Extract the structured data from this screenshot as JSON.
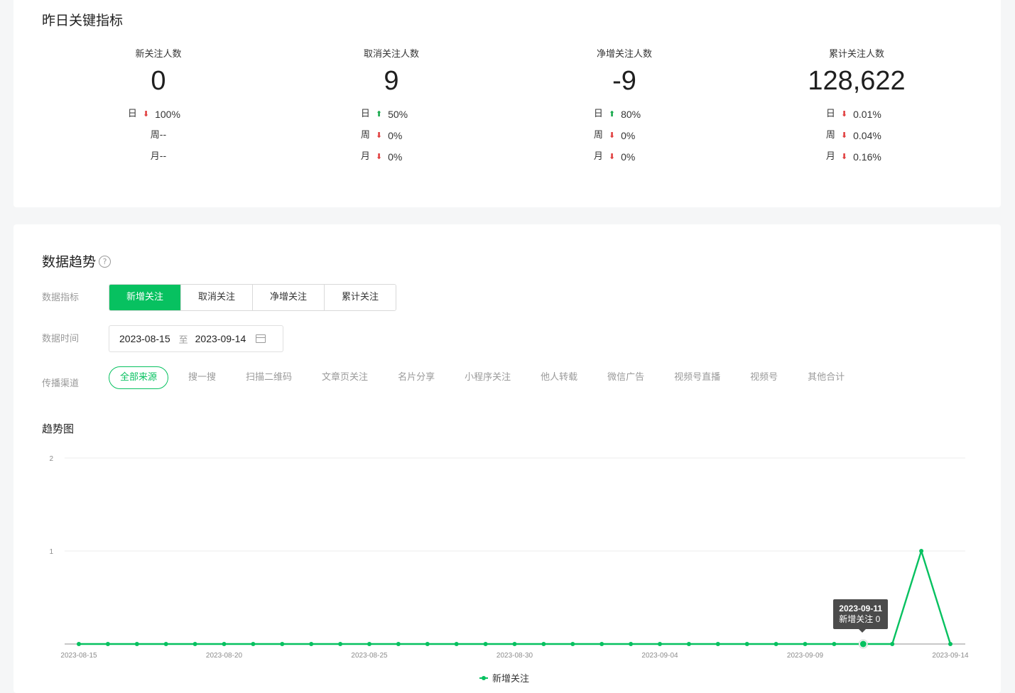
{
  "metrics_section": {
    "title": "昨日关键指标",
    "metrics": [
      {
        "label": "新关注人数",
        "value": "0",
        "rows": [
          {
            "period": "日",
            "direction": "down",
            "pct": "100%"
          },
          {
            "period": "周--",
            "direction": "none",
            "pct": ""
          },
          {
            "period": "月--",
            "direction": "none",
            "pct": ""
          }
        ]
      },
      {
        "label": "取消关注人数",
        "value": "9",
        "rows": [
          {
            "period": "日",
            "direction": "up",
            "pct": "50%"
          },
          {
            "period": "周",
            "direction": "down",
            "pct": "0%"
          },
          {
            "period": "月",
            "direction": "down",
            "pct": "0%"
          }
        ]
      },
      {
        "label": "净增关注人数",
        "value": "-9",
        "rows": [
          {
            "period": "日",
            "direction": "up",
            "pct": "80%"
          },
          {
            "period": "周",
            "direction": "down",
            "pct": "0%"
          },
          {
            "period": "月",
            "direction": "down",
            "pct": "0%"
          }
        ]
      },
      {
        "label": "累计关注人数",
        "value": "128,622",
        "rows": [
          {
            "period": "日",
            "direction": "down",
            "pct": "0.01%"
          },
          {
            "period": "周",
            "direction": "down",
            "pct": "0.04%"
          },
          {
            "period": "月",
            "direction": "down",
            "pct": "0.16%"
          }
        ]
      }
    ]
  },
  "trend_section": {
    "title": "数据趋势",
    "help_icon": "?",
    "metric_label": "数据指标",
    "metric_tabs": [
      "新增关注",
      "取消关注",
      "净增关注",
      "累计关注"
    ],
    "active_metric": 0,
    "time_label": "数据时间",
    "date_from": "2023-08-15",
    "date_sep": "至",
    "date_to": "2023-09-14",
    "channel_label": "传播渠道",
    "channels": [
      "全部来源",
      "搜一搜",
      "扫描二维码",
      "文章页关注",
      "名片分享",
      "小程序关注",
      "他人转载",
      "微信广告",
      "视频号直播",
      "视频号",
      "其他合计"
    ],
    "active_channel": 0,
    "chart_title": "趋势图",
    "tooltip": {
      "date": "2023-09-11",
      "text": "新增关注 0"
    }
  },
  "colors": {
    "accent": "#07c160",
    "down": "#e03e3e",
    "up": "#14a84a"
  },
  "chart_data": {
    "type": "line",
    "title": "",
    "xlabel": "",
    "ylabel": "",
    "ylim": [
      0,
      2
    ],
    "yticks": [
      1,
      2
    ],
    "x_tick_labels": [
      "2023-08-15",
      "2023-08-20",
      "2023-08-25",
      "2023-08-30",
      "2023-09-04",
      "2023-09-09",
      "2023-09-14"
    ],
    "x": [
      "2023-08-15",
      "2023-08-16",
      "2023-08-17",
      "2023-08-18",
      "2023-08-19",
      "2023-08-20",
      "2023-08-21",
      "2023-08-22",
      "2023-08-23",
      "2023-08-24",
      "2023-08-25",
      "2023-08-26",
      "2023-08-27",
      "2023-08-28",
      "2023-08-29",
      "2023-08-30",
      "2023-08-31",
      "2023-09-01",
      "2023-09-02",
      "2023-09-03",
      "2023-09-04",
      "2023-09-05",
      "2023-09-06",
      "2023-09-07",
      "2023-09-08",
      "2023-09-09",
      "2023-09-10",
      "2023-09-11",
      "2023-09-12",
      "2023-09-13",
      "2023-09-14"
    ],
    "series": [
      {
        "name": "新增关注",
        "color": "#07c160",
        "values": [
          0,
          0,
          0,
          0,
          0,
          0,
          0,
          0,
          0,
          0,
          0,
          0,
          0,
          0,
          0,
          0,
          0,
          0,
          0,
          0,
          0,
          0,
          0,
          0,
          0,
          0,
          0,
          0,
          0,
          1,
          0
        ]
      }
    ],
    "highlight_date": "2023-09-11",
    "legend": "bottom-center",
    "grid": true
  }
}
